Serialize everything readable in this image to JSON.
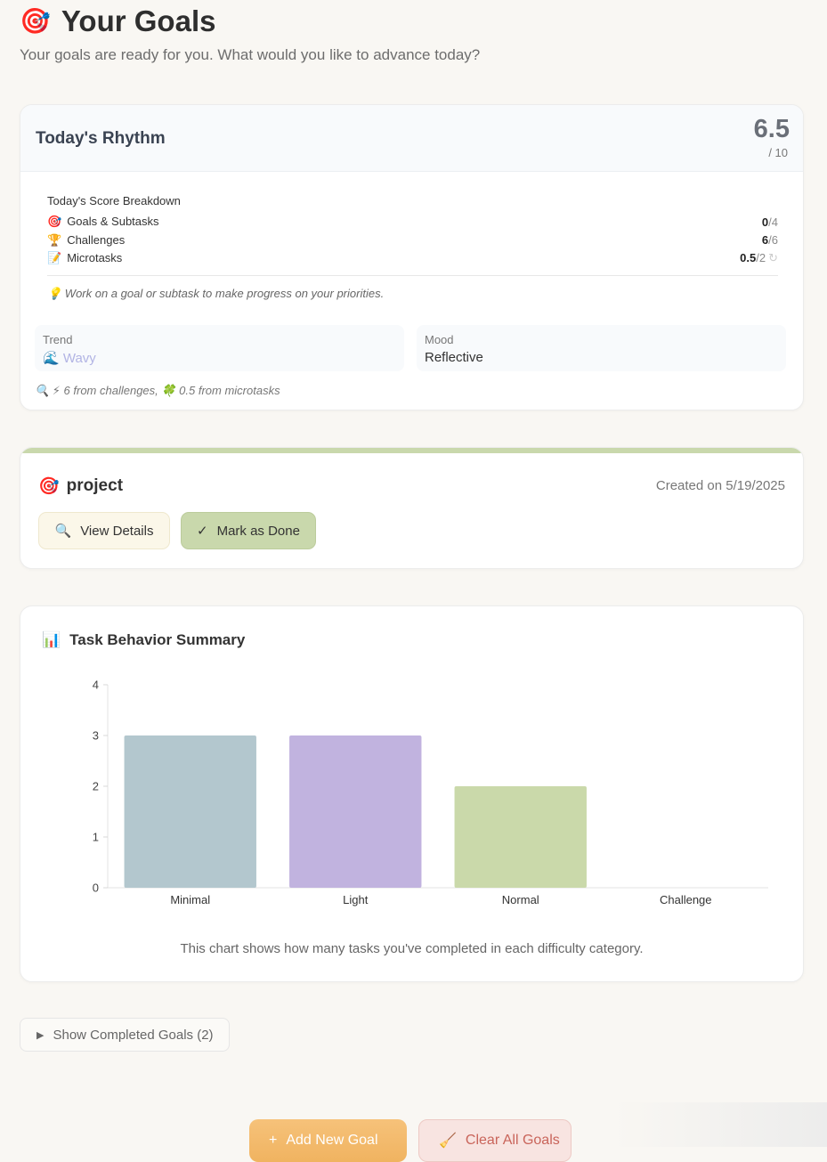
{
  "header": {
    "icon": "🎯",
    "title": "Your Goals",
    "subtitle": "Your goals are ready for you. What would you like to advance today?"
  },
  "rhythm": {
    "title": "Today's Rhythm",
    "score": "6.5",
    "score_max": "/ 10",
    "breakdown_title": "Today's Score Breakdown",
    "rows": [
      {
        "icon": "🎯",
        "label": "Goals & Subtasks",
        "value": "0",
        "denominator": "/4"
      },
      {
        "icon": "🏆",
        "label": "Challenges",
        "value": "6",
        "denominator": "/6"
      },
      {
        "icon": "📝",
        "label": "Microtasks",
        "value": "0.5",
        "denominator": "/2",
        "extra_icon": "↻"
      }
    ],
    "tip": "💡 Work on a goal or subtask to make progress on your priorities.",
    "trend_label": "Trend",
    "trend_value": "🌊 Wavy",
    "mood_label": "Mood",
    "mood_value": "Reflective",
    "energy_note": "🔍 ⚡ 6 from challenges, 🍀 0.5 from microtasks"
  },
  "project": {
    "icon": "🎯",
    "name": "project",
    "created": "Created on 5/19/2025",
    "view_icon": "🔍",
    "view_label": "View Details",
    "done_icon": "✓",
    "done_label": "Mark as Done",
    "accent": "#c9d8ac"
  },
  "summary": {
    "icon": "📊",
    "title": "Task Behavior Summary",
    "caption": "This chart shows how many tasks you've completed in each difficulty category."
  },
  "chart_data": {
    "type": "bar",
    "categories": [
      "Minimal",
      "Light",
      "Normal",
      "Challenge"
    ],
    "values": [
      3,
      3,
      2,
      0
    ],
    "colors": [
      "#b3c7ce",
      "#c1b3df",
      "#cad9aa",
      "#f0c27e"
    ],
    "ylim": [
      0,
      4
    ],
    "yticks": [
      0,
      1,
      2,
      3,
      4
    ],
    "title": "",
    "xlabel": "",
    "ylabel": "",
    "grid": false
  },
  "completed": {
    "arrow": "▶",
    "label": "Show Completed Goals (2)"
  },
  "actions": {
    "add_icon": "+",
    "add_label": "Add New Goal",
    "clear_icon": "🧹",
    "clear_label": "Clear All Goals"
  }
}
